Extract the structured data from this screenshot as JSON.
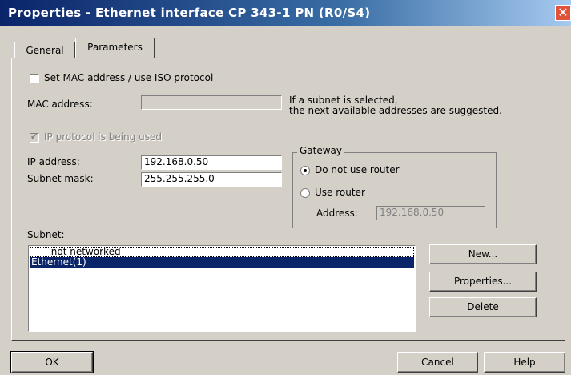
{
  "window": {
    "title": "Properties - Ethernet interface  CP 343-1 PN (R0/S4)",
    "close_glyph": "✕"
  },
  "tabs": [
    {
      "label": "General"
    },
    {
      "label": "Parameters"
    }
  ],
  "mac_section": {
    "checkbox_label": "Set MAC address / use ISO protocol",
    "mac_label": "MAC address:",
    "mac_value": "",
    "hint_line1": "If a subnet is selected,",
    "hint_line2": "the next available addresses are suggested."
  },
  "ip_section": {
    "checkbox_label": "IP protocol is being used",
    "checked": true,
    "ip_label": "IP address:",
    "ip_value": "192.168.0.50",
    "mask_label": "Subnet mask:",
    "mask_value": "255.255.255.0"
  },
  "gateway": {
    "title": "Gateway",
    "option_no_router": "Do not use router",
    "option_use_router": "Use router",
    "selected": "Do not use router",
    "address_label": "Address:",
    "address_value": "192.168.0.50"
  },
  "subnet": {
    "label": "Subnet:",
    "items": [
      "--- not networked ---",
      "Ethernet(1)"
    ],
    "selected": "Ethernet(1)",
    "new_button": "New...",
    "properties_button": "Properties...",
    "delete_button": "Delete"
  },
  "footer": {
    "ok_button": "OK",
    "cancel_button": "Cancel",
    "help_button": "Help"
  }
}
